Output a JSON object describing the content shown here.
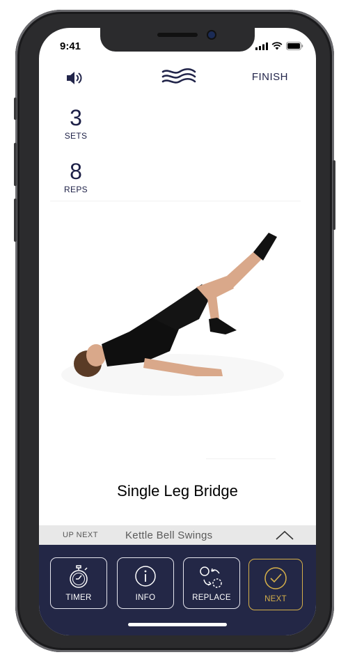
{
  "status_bar": {
    "time": "9:41"
  },
  "header": {
    "finish_label": "FINISH"
  },
  "stats": {
    "sets_value": "3",
    "sets_label": "SETS",
    "reps_value": "8",
    "reps_label": "REPS"
  },
  "exercise": {
    "name": "Single Leg Bridge"
  },
  "up_next": {
    "label": "UP NEXT",
    "name": "Kettle Bell Swings"
  },
  "actions": {
    "timer": "TIMER",
    "info": "INFO",
    "replace": "REPLACE",
    "next": "NEXT"
  },
  "colors": {
    "navy": "#232746",
    "accent_gold": "#d6b04a",
    "text_navy": "#1c1f46",
    "upnext_bg": "#e8e8e8"
  },
  "icons": [
    "speaker-icon",
    "waves-logo",
    "stopwatch-icon",
    "info-icon",
    "replace-icon",
    "check-icon",
    "chevron-up-icon"
  ]
}
